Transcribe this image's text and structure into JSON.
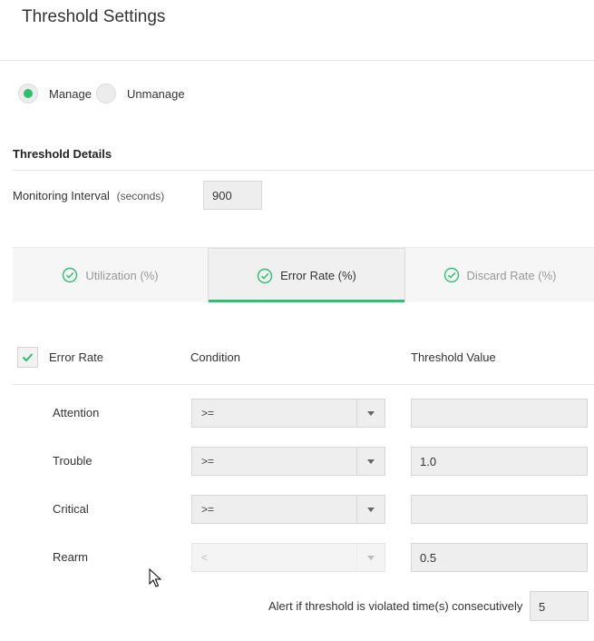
{
  "page": {
    "title": "Threshold Settings"
  },
  "mode": {
    "options": [
      {
        "label": "Manage",
        "selected": true
      },
      {
        "label": "Unmanage",
        "selected": false
      }
    ]
  },
  "details": {
    "heading": "Threshold Details",
    "interval_label": "Monitoring Interval",
    "interval_unit": "(seconds)",
    "interval_value": "900"
  },
  "tabs": [
    {
      "label": "Utilization (%)",
      "active": false
    },
    {
      "label": "Error Rate (%)",
      "active": true
    },
    {
      "label": "Discard Rate (%)",
      "active": false
    }
  ],
  "table": {
    "enabled_label": "Error Rate",
    "enabled": true,
    "condition_header": "Condition",
    "value_header": "Threshold Value",
    "rows": [
      {
        "label": "Attention",
        "condition": ">=",
        "value": "",
        "disabled": false
      },
      {
        "label": "Trouble",
        "condition": ">=",
        "value": "1.0",
        "disabled": false
      },
      {
        "label": "Critical",
        "condition": ">=",
        "value": "",
        "disabled": false
      },
      {
        "label": "Rearm",
        "condition": "<",
        "value": "0.5",
        "disabled": true
      }
    ]
  },
  "alert": {
    "label": "Alert if threshold is violated time(s) consecutively",
    "value": "5"
  },
  "colors": {
    "accent": "#2fbf71",
    "field_bg": "#eeeeee"
  }
}
